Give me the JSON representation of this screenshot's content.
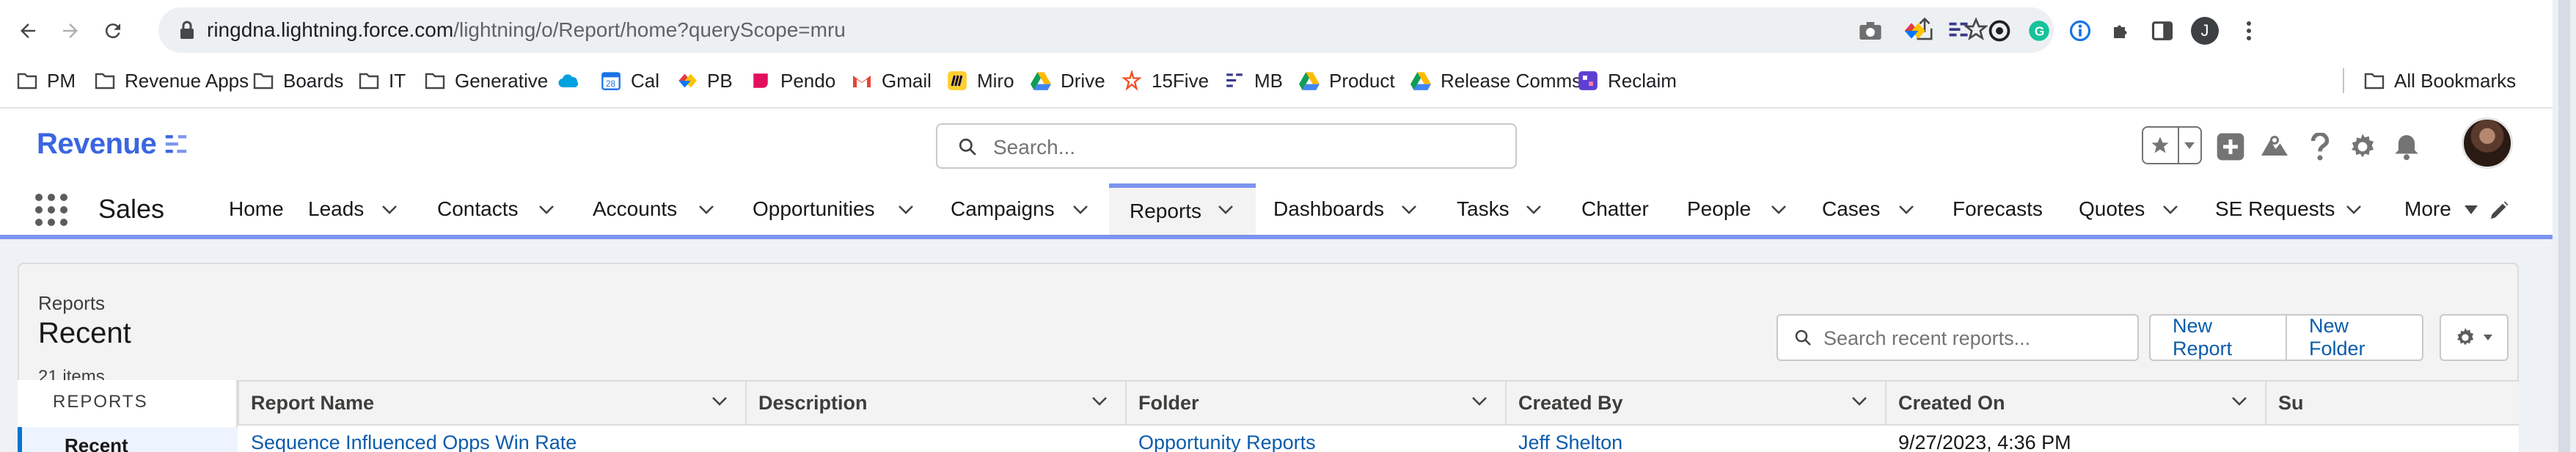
{
  "browser": {
    "url_host": "ringdna.lightning.force.com",
    "url_path": "/lightning/o/Report/home?queryScope=mru",
    "profile_initial": "J",
    "bookmarks": [
      {
        "label": "PM",
        "icon": "folder-icon"
      },
      {
        "label": "Revenue Apps",
        "icon": "folder-icon"
      },
      {
        "label": "Boards",
        "icon": "folder-icon"
      },
      {
        "label": "IT",
        "icon": "folder-icon"
      },
      {
        "label": "Generative",
        "icon": "folder-icon"
      },
      {
        "label": "",
        "icon": "salesforce-cloud-icon"
      },
      {
        "label": "Cal",
        "icon": "calendar-icon"
      },
      {
        "label": "PB",
        "icon": "productboard-icon"
      },
      {
        "label": "Pendo",
        "icon": "pendo-icon"
      },
      {
        "label": "Gmail",
        "icon": "gmail-icon"
      },
      {
        "label": "Miro",
        "icon": "miro-icon"
      },
      {
        "label": "Drive",
        "icon": "drive-icon"
      },
      {
        "label": "15Five",
        "icon": "fifteenfive-icon"
      },
      {
        "label": "MB",
        "icon": "revenue-logo-icon"
      },
      {
        "label": "Product",
        "icon": "drive-icon"
      },
      {
        "label": "Release Comms",
        "icon": "drive-icon"
      },
      {
        "label": "Reclaim",
        "icon": "reclaim-icon"
      }
    ],
    "all_bookmarks_label": "All Bookmarks"
  },
  "header": {
    "logo_text": "Revenue",
    "search_placeholder": "Search..."
  },
  "app_nav": {
    "app_name": "Sales",
    "items": [
      {
        "label": "Home",
        "has_menu": false
      },
      {
        "label": "Leads",
        "has_menu": true
      },
      {
        "label": "Contacts",
        "has_menu": true
      },
      {
        "label": "Accounts",
        "has_menu": true
      },
      {
        "label": "Opportunities",
        "has_menu": true
      },
      {
        "label": "Campaigns",
        "has_menu": true
      },
      {
        "label": "Reports",
        "has_menu": true,
        "active": true
      },
      {
        "label": "Dashboards",
        "has_menu": true
      },
      {
        "label": "Tasks",
        "has_menu": true
      },
      {
        "label": "Chatter",
        "has_menu": false
      },
      {
        "label": "People",
        "has_menu": true
      },
      {
        "label": "Cases",
        "has_menu": true
      },
      {
        "label": "Forecasts",
        "has_menu": false
      },
      {
        "label": "Quotes",
        "has_menu": true
      },
      {
        "label": "SE Requests",
        "has_menu": true
      },
      {
        "label": "More",
        "has_menu": true
      }
    ]
  },
  "list_header": {
    "breadcrumb": "Reports",
    "title": "Recent",
    "count": "21 items",
    "search_placeholder": "Search recent reports...",
    "new_report_label": "New Report",
    "new_folder_label": "New Folder"
  },
  "sidebar": {
    "section_title": "REPORTS",
    "items": [
      {
        "label": "Recent",
        "selected": true
      }
    ]
  },
  "table": {
    "columns": [
      "Report Name",
      "Description",
      "Folder",
      "Created By",
      "Created On",
      "Su"
    ],
    "rows": [
      {
        "report_name": "Sequence Influenced Opps Win Rate",
        "description": "",
        "folder": "Opportunity Reports",
        "created_by": "Jeff Shelton",
        "created_on": "9/27/2023, 4:36 PM"
      }
    ]
  },
  "colors": {
    "accent": "#0176d3",
    "link": "#0b5cab",
    "nav_active": "#7c94ef",
    "brand": "#3a66e0"
  }
}
